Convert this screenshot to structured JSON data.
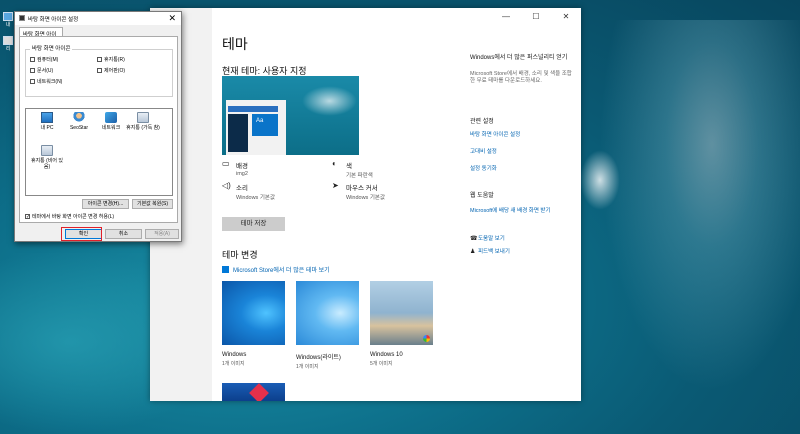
{
  "desktop": {
    "icons": [
      {
        "label": "내",
        "icon": "monitor-icon"
      },
      {
        "label": "리",
        "icon": "recycle-bin-icon"
      }
    ]
  },
  "settings": {
    "title": "테마",
    "current_theme": "현재 테마: 사용자 지정",
    "preview_tile_text": "Aa",
    "props": {
      "background": {
        "label": "배경",
        "value": "img2",
        "icon": "picture-icon"
      },
      "color": {
        "label": "색",
        "value": "기본 파란색",
        "icon": "palette-icon"
      },
      "sound": {
        "label": "소리",
        "value": "Windows 기본값",
        "icon": "speaker-icon"
      },
      "cursor": {
        "label": "마우스 커서",
        "value": "Windows 기본값",
        "icon": "cursor-icon"
      }
    },
    "save_theme": "테마 저장",
    "change_theme": "테마 변경",
    "store_link": "Microsoft Store에서 더 많은 테마 보기",
    "themes": [
      {
        "name": "Windows",
        "count": "1개 이미지"
      },
      {
        "name": "Windows(라이트)",
        "count": "1개 이미지"
      },
      {
        "name": "Windows 10",
        "count": "5개 이미지"
      }
    ],
    "right": {
      "personalize_title": "Windows에서 더 많은 퍼스널리티 얻기",
      "personalize_desc": "Microsoft Store에서 배경, 소리 및 색을 조합한 무료 테마를 다운로드하세요.",
      "related_title": "관련 설정",
      "related_links": [
        "바탕 화면 아이콘 설정",
        "고대비 설정",
        "설정 동기화"
      ],
      "help_title": "웹 도움말",
      "help_link": "Microsoft에 배당 새 배경 화면 받기",
      "get_help": "도움말 보기",
      "feedback": "피드백 보내기"
    }
  },
  "dialog": {
    "title": "바탕 화면 아이콘 설정",
    "tab": "바탕 화면 아이콘",
    "group_label": "바탕 화면 아이콘",
    "checkboxes": [
      {
        "label": "컴퓨터(M)",
        "checked": false
      },
      {
        "label": "휴지통(R)",
        "checked": false
      },
      {
        "label": "문서(U)",
        "checked": false
      },
      {
        "label": "제어판(O)",
        "checked": false
      },
      {
        "label": "네트워크(N)",
        "checked": false
      }
    ],
    "list_icons": [
      {
        "label": "내 PC",
        "icon": "pc-icon"
      },
      {
        "label": "SeoStar",
        "icon": "user-folder-icon"
      },
      {
        "label": "네트워크",
        "icon": "network-icon"
      },
      {
        "label": "휴지통 (가득 참)",
        "icon": "recycle-bin-full-icon"
      },
      {
        "label": "휴지통 (비어 있음)",
        "icon": "recycle-bin-empty-icon"
      }
    ],
    "change_icon": "아이콘 변경(H)...",
    "restore_default": "기본값 복원(S)",
    "allow_themes": "테마에서 바탕 화면 아이콘 변경 허용(L)",
    "allow_themes_checked": true,
    "ok": "확인",
    "cancel": "취소",
    "apply": "적용(A)"
  },
  "window_controls": {
    "minimize": "—",
    "maximize": "☐",
    "close": "✕"
  }
}
